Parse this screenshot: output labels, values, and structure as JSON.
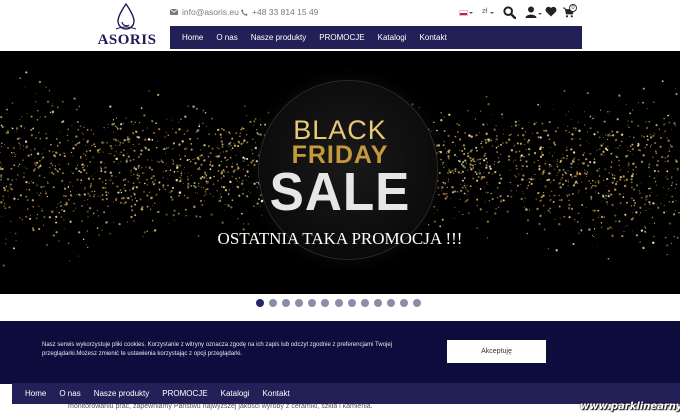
{
  "brand": {
    "logo_text": "ASORIS",
    "color": "#1d1a55"
  },
  "contact": {
    "email": "info@asoris.eu",
    "phone": "+48 33 814 15 49",
    "email_icon": "envelope-icon",
    "phone_icon": "phone-icon"
  },
  "header_tools": {
    "language": "pl",
    "currency": "zł",
    "icons": [
      "search-icon",
      "user-icon",
      "heart-icon",
      "cart-icon"
    ],
    "cart_count": "0"
  },
  "nav": {
    "items": [
      "Home",
      "O nas",
      "Nasze produkty",
      "PROMOCJE",
      "Katalogi",
      "Kontakt"
    ],
    "color": "#231f57"
  },
  "hero": {
    "line1": "BLACK",
    "line2": "FRIDAY",
    "line3": "SALE",
    "caption": "OSTATNIA TAKA PROMOCJA !!!",
    "gold": "#c69a3c"
  },
  "slider": {
    "total_slides": 13,
    "active_index": 0
  },
  "cookie": {
    "text": "Nasz serwis wykorzystuje pliki cookies. Korzystanie z witryny oznacza zgodę na ich zapis lub odczyt zgodnie z preferencjami Twojej przeglądarki.Możesz zmienić te ustawienia korzystając z opcji przeglądarki.",
    "accept_label": "Akceptuję",
    "background": "#0d0c3c"
  },
  "page_hint": "monitorowaniu prac, zapewniamy Państwu najwyższej jakości wyroby z ceramiki, szkła i kamienia.",
  "watermark": "www.parklinearny.pl"
}
